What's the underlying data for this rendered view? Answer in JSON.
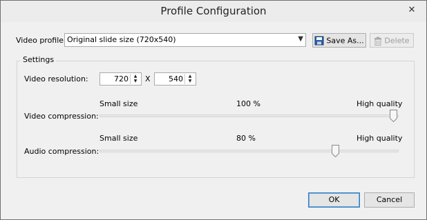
{
  "window": {
    "title": "Profile Configuration",
    "close_glyph": "✕"
  },
  "video_profile": {
    "label": "Video profile:",
    "selected": "Original slide size (720x540)",
    "save_as_label": "Save As...",
    "delete_label": "Delete"
  },
  "settings": {
    "group_title": "Settings",
    "resolution": {
      "label": "Video resolution:",
      "width": "720",
      "separator": "X",
      "height": "540"
    },
    "video_compression": {
      "label": "Video compression:",
      "min_label": "Small size",
      "max_label": "High quality",
      "value_text": "100 %",
      "value": 100
    },
    "audio_compression": {
      "label": "Audio compression:",
      "min_label": "Small size",
      "max_label": "High quality",
      "value_text": "80 %",
      "value": 80
    }
  },
  "footer": {
    "ok_label": "OK",
    "cancel_label": "Cancel"
  },
  "icons": {
    "save": "floppy-disk-icon",
    "delete": "trash-icon",
    "dropdown": "chevron-down-icon",
    "spin": "spin-arrows-icon"
  }
}
